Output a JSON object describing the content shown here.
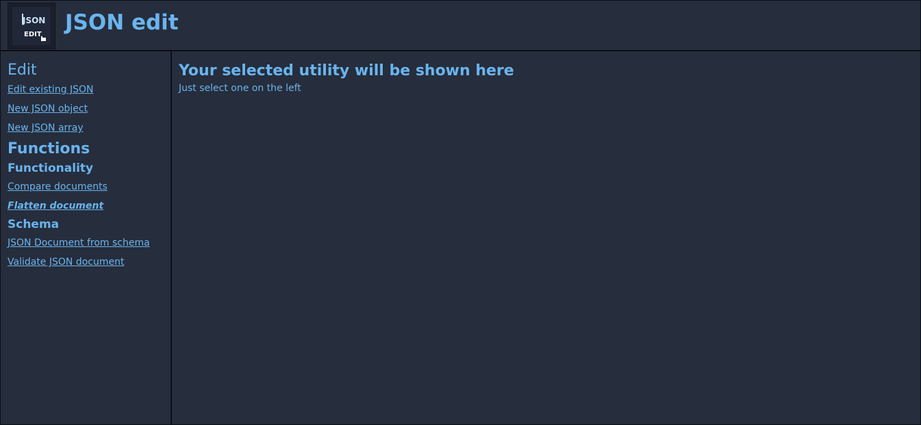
{
  "header": {
    "logo_text_top": "JSON",
    "logo_text_bottom": "EDIT",
    "title": "JSON edit"
  },
  "sidebar": {
    "edit_heading": "Edit",
    "edit_links": [
      "Edit existing JSON",
      "New JSON object",
      "New JSON array"
    ],
    "functions_heading": "Functions",
    "functionality_heading": "Functionality",
    "functionality_links": [
      "Compare documents",
      "Flatten document"
    ],
    "schema_heading": "Schema",
    "schema_links": [
      "JSON Document from schema",
      "Validate JSON document"
    ],
    "active_link": "Flatten document"
  },
  "main": {
    "title": "Your selected utility will be shown here",
    "subtitle": "Just select one on the left"
  },
  "colors": {
    "background": "#262d3c",
    "text": "#6ab4ee",
    "border": "#0b0e14"
  }
}
